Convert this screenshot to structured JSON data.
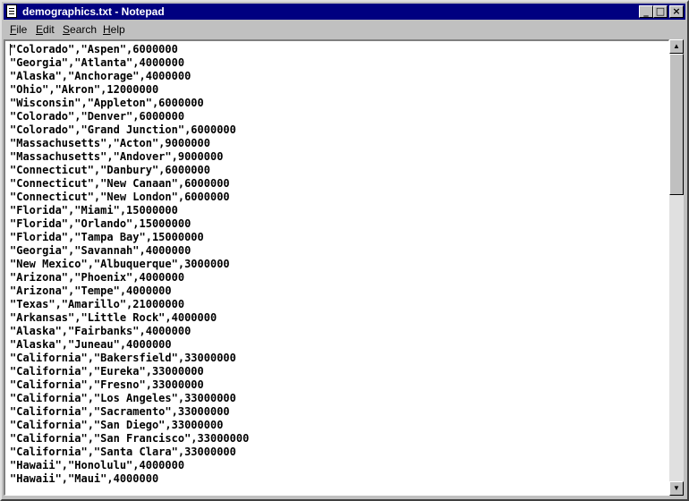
{
  "window": {
    "title": "demographics.txt - Notepad",
    "controls": {
      "minimize": "_",
      "maximize": "□",
      "close": "×"
    }
  },
  "menu": {
    "items": [
      {
        "accel": "F",
        "rest": "ile"
      },
      {
        "accel": "E",
        "rest": "dit"
      },
      {
        "accel": "S",
        "rest": "earch"
      },
      {
        "accel": "H",
        "rest": "elp"
      }
    ]
  },
  "document": {
    "lines": [
      "\"Colorado\",\"Aspen\",6000000",
      "\"Georgia\",\"Atlanta\",4000000",
      "\"Alaska\",\"Anchorage\",4000000",
      "\"Ohio\",\"Akron\",12000000",
      "\"Wisconsin\",\"Appleton\",6000000",
      "\"Colorado\",\"Denver\",6000000",
      "\"Colorado\",\"Grand Junction\",6000000",
      "\"Massachusetts\",\"Acton\",9000000",
      "\"Massachusetts\",\"Andover\",9000000",
      "\"Connecticut\",\"Danbury\",6000000",
      "\"Connecticut\",\"New Canaan\",6000000",
      "\"Connecticut\",\"New London\",6000000",
      "\"Florida\",\"Miami\",15000000",
      "\"Florida\",\"Orlando\",15000000",
      "\"Florida\",\"Tampa Bay\",15000000",
      "\"Georgia\",\"Savannah\",4000000",
      "\"New Mexico\",\"Albuquerque\",3000000",
      "\"Arizona\",\"Phoenix\",4000000",
      "\"Arizona\",\"Tempe\",4000000",
      "\"Texas\",\"Amarillo\",21000000",
      "\"Arkansas\",\"Little Rock\",4000000",
      "\"Alaska\",\"Fairbanks\",4000000",
      "\"Alaska\",\"Juneau\",4000000",
      "\"California\",\"Bakersfield\",33000000",
      "\"California\",\"Eureka\",33000000",
      "\"California\",\"Fresno\",33000000",
      "\"California\",\"Los Angeles\",33000000",
      "\"California\",\"Sacramento\",33000000",
      "\"California\",\"San Diego\",33000000",
      "\"California\",\"San Francisco\",33000000",
      "\"California\",\"Santa Clara\",33000000",
      "\"Hawaii\",\"Honolulu\",4000000",
      "\"Hawaii\",\"Maui\",4000000"
    ]
  },
  "scrollbar": {
    "up_arrow": "▲",
    "down_arrow": "▼"
  },
  "colors": {
    "title_bar": "#000080",
    "face": "#c0c0c0",
    "text_bg": "#ffffff"
  }
}
